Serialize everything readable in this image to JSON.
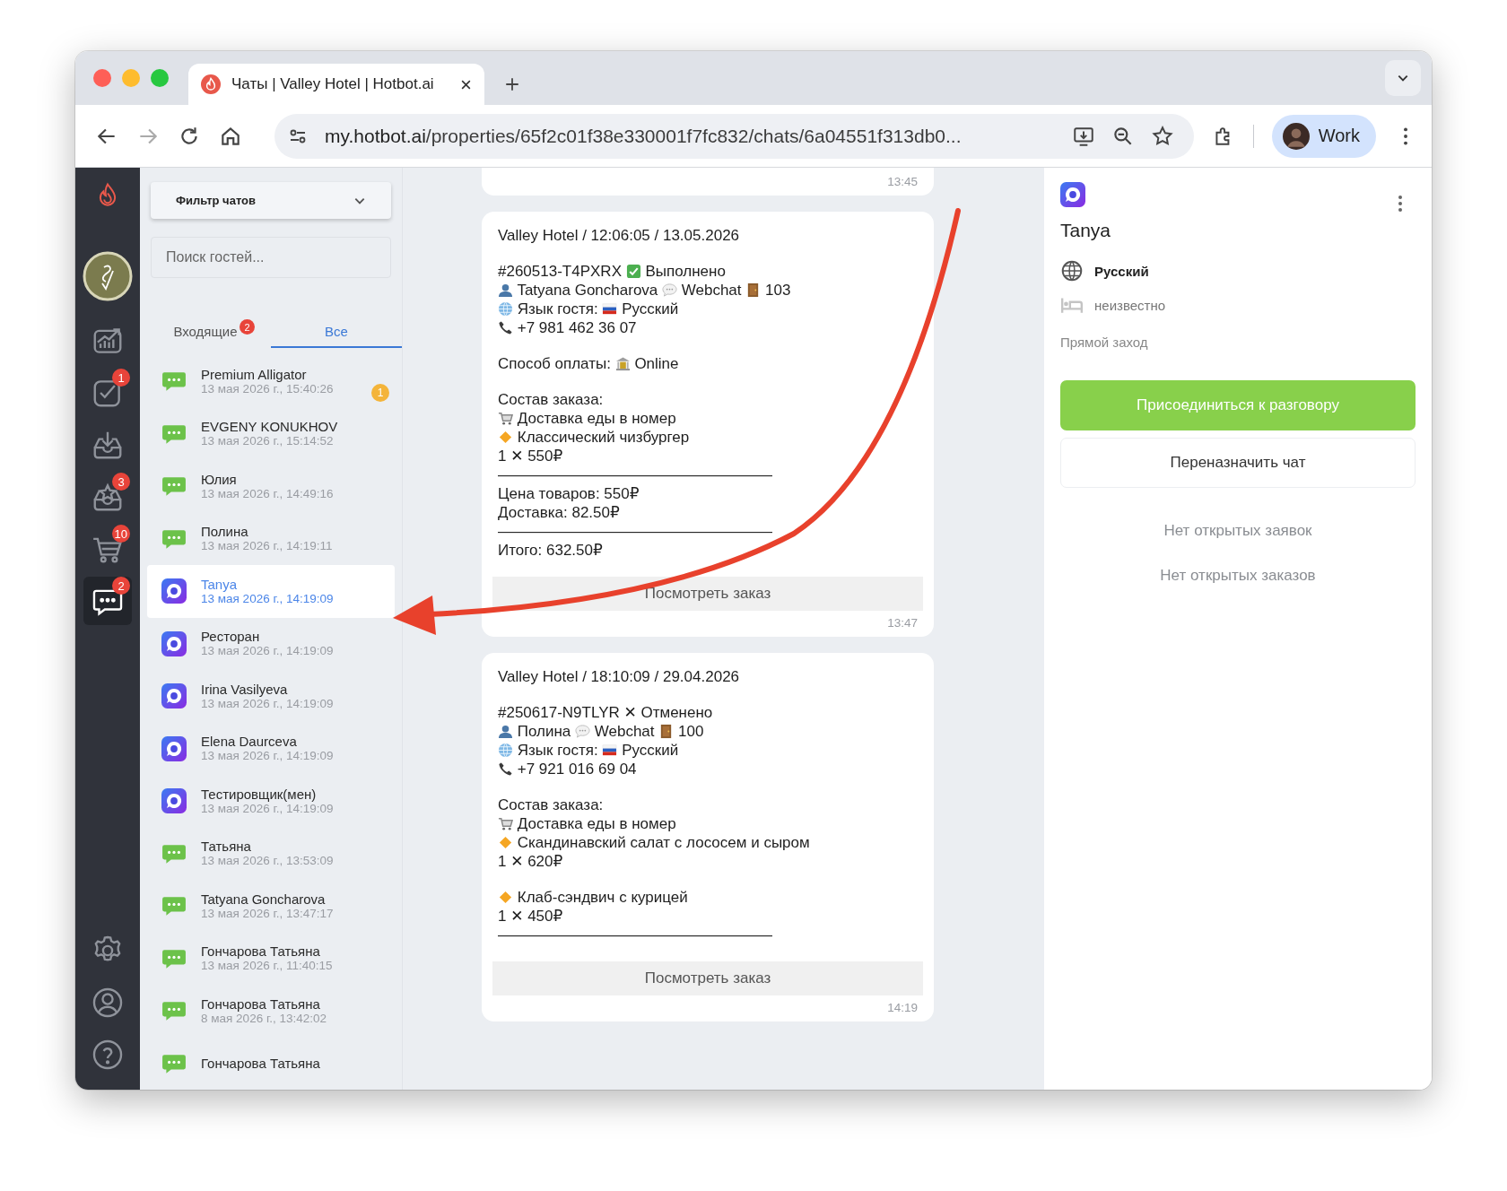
{
  "browser": {
    "tab": {
      "title": "Чаты | Valley Hotel | Hotbot.ai"
    },
    "url": {
      "host": "my.hotbot.ai",
      "path": "/properties/65f2c01f38e330001f7fc832/chats/6a04551f313db0..."
    },
    "profile": {
      "label": "Work"
    }
  },
  "rail": {
    "items": [
      {
        "kind": "analytics",
        "selected": false
      },
      {
        "kind": "tasks",
        "badge": "1",
        "selected": false
      },
      {
        "kind": "inbox",
        "selected": false
      },
      {
        "kind": "starred",
        "badge": "3",
        "selected": false
      },
      {
        "kind": "cart",
        "badge": "10",
        "selected": false
      },
      {
        "kind": "chats",
        "badge": "2",
        "selected": true
      }
    ],
    "bottom": [
      {
        "kind": "settings"
      },
      {
        "kind": "profile"
      },
      {
        "kind": "help"
      }
    ]
  },
  "chat_list": {
    "filter": {
      "label": "Фильтр чатов"
    },
    "search": {
      "placeholder": "Поиск гостей..."
    },
    "tabs": [
      {
        "label": "Входящие",
        "badge": "2",
        "selected": false
      },
      {
        "label": "Все",
        "selected": true
      }
    ],
    "items": [
      {
        "name": "Premium Alligator",
        "date": "13 мая 2026 г., 15:40:26",
        "kind": "webchat",
        "selected": false,
        "badge": "1"
      },
      {
        "name": "EVGENY KONUKHOV",
        "date": "13 мая 2026 г., 15:14:52",
        "kind": "webchat",
        "selected": false
      },
      {
        "name": "Юлия",
        "date": "13 мая 2026 г., 14:49:16",
        "kind": "webchat",
        "selected": false
      },
      {
        "name": "Полина",
        "date": "13 мая 2026 г., 14:19:11",
        "kind": "webchat",
        "selected": false
      },
      {
        "name": "Tanya",
        "date": "13 мая 2026 г., 14:19:09",
        "kind": "app",
        "selected": true
      },
      {
        "name": "Ресторан",
        "date": "13 мая 2026 г., 14:19:09",
        "kind": "app",
        "selected": false
      },
      {
        "name": "Irina Vasilyeva",
        "date": "13 мая 2026 г., 14:19:09",
        "kind": "app",
        "selected": false
      },
      {
        "name": "Elena Daurceva",
        "date": "13 мая 2026 г., 14:19:09",
        "kind": "app",
        "selected": false
      },
      {
        "name": "Тестировщик(мен)",
        "date": "13 мая 2026 г., 14:19:09",
        "kind": "app",
        "selected": false
      },
      {
        "name": "Татьяна",
        "date": "13 мая 2026 г., 13:53:09",
        "kind": "webchat",
        "selected": false
      },
      {
        "name": "Tatyana Goncharova",
        "date": "13 мая 2026 г., 13:47:17",
        "kind": "webchat",
        "selected": false
      },
      {
        "name": "Гончарова Татьяна",
        "date": "13 мая 2026 г., 11:40:15",
        "kind": "webchat",
        "selected": false
      },
      {
        "name": "Гончарова Татьяна",
        "date": "8 мая 2026 г., 13:42:02",
        "kind": "webchat",
        "selected": false
      },
      {
        "name": "Гончарова Татьяна",
        "kind": "webchat",
        "selected": false
      }
    ]
  },
  "messages": [
    {
      "time": "13:45"
    },
    {
      "header": "Valley Hotel / 12:06:05 / 13.05.2026",
      "paragraphs": [
        [
          [
            "#260513-T4PXRX ",
            {
              "kind": "check"
            },
            " Выполнено"
          ],
          [
            {
              "kind": "person"
            },
            " Tatyana Goncharova ",
            {
              "kind": "bubble"
            },
            " Webchat ",
            {
              "kind": "door"
            },
            " 103"
          ],
          [
            {
              "kind": "globe"
            },
            " Язык гостя: ",
            {
              "kind": "flag"
            },
            " Русский"
          ],
          [
            {
              "kind": "phone"
            },
            " +7 981 462 36 07"
          ]
        ],
        [
          [
            "Способ оплаты: ",
            {
              "kind": "bank"
            },
            " Online"
          ]
        ],
        [
          [
            "Состав заказа:"
          ],
          [
            {
              "kind": "cart"
            },
            " Доставка еды в номер"
          ],
          [
            {
              "kind": "diamond"
            },
            " Классический чизбургер"
          ],
          [
            "1 ✕ 550₽"
          ],
          [
            "——————————————————"
          ],
          [
            "Цена товаров: 550₽"
          ],
          [
            "Доставка: 82.50₽"
          ],
          [
            "——————————————————"
          ],
          [
            "Итого: 632.50₽"
          ]
        ]
      ],
      "button": "Посмотреть заказ",
      "time": "13:47"
    },
    {
      "header": "Valley Hotel / 18:10:09 / 29.04.2026",
      "paragraphs": [
        [
          [
            "#250617-N9TLYR ✕ Отменено"
          ],
          [
            {
              "kind": "person"
            },
            " Полина ",
            {
              "kind": "bubble"
            },
            " Webchat ",
            {
              "kind": "door"
            },
            " 100"
          ],
          [
            {
              "kind": "globe"
            },
            " Язык гостя: ",
            {
              "kind": "flag"
            },
            " Русский"
          ],
          [
            {
              "kind": "phone"
            },
            " +7 921 016 69 04"
          ]
        ],
        [
          [
            "Состав заказа:"
          ],
          [
            {
              "kind": "cart"
            },
            " Доставка еды в номер"
          ],
          [
            {
              "kind": "diamond"
            },
            " Скандинавский салат с лососем и сыром"
          ],
          [
            "1 ✕ 620₽"
          ]
        ],
        [
          [
            {
              "kind": "diamond"
            },
            " Клаб-сэндвич с курицей"
          ],
          [
            "1 ✕ 450₽"
          ],
          [
            "——————————————————"
          ]
        ]
      ],
      "button": "Посмотреть заказ",
      "time": "14:19"
    }
  ],
  "guest": {
    "name": "Tanya",
    "language": "Русский",
    "room": "неизвестно",
    "source": "Прямой заход"
  },
  "actions": [
    {
      "label": "Присоединиться к разговору",
      "kind": "primary"
    },
    {
      "label": "Переназначить чат",
      "kind": "secondary"
    }
  ],
  "notes": [
    "Нет открытых заявок",
    "Нет открытых заказов"
  ]
}
